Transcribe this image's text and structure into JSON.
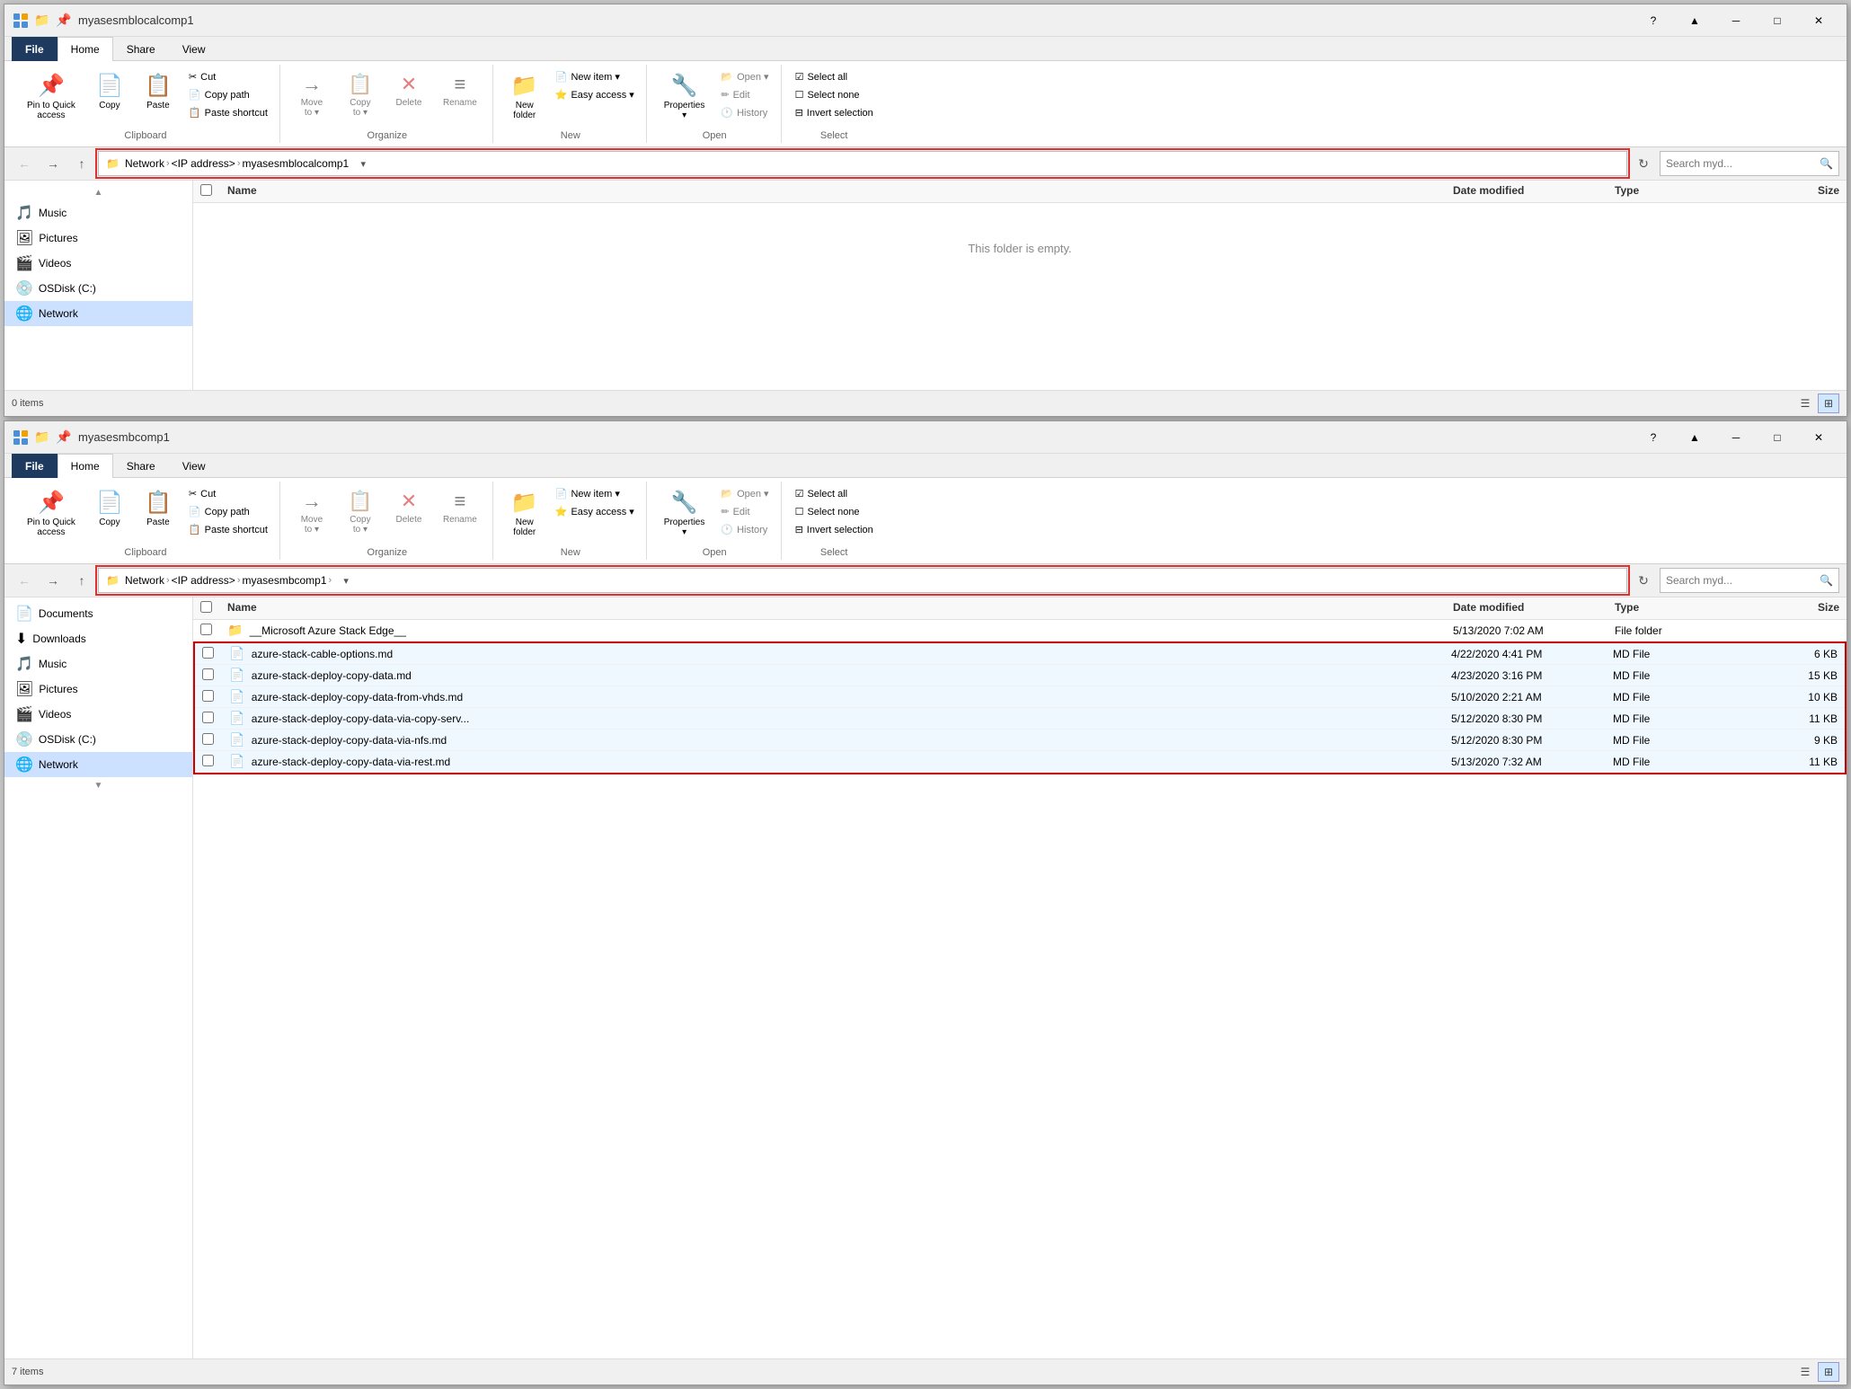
{
  "window1": {
    "title": "myasesmblocalcomp1",
    "tabs": [
      "File",
      "Home",
      "Share",
      "View"
    ],
    "active_tab": "Home",
    "ribbon": {
      "groups": {
        "clipboard": {
          "label": "Clipboard",
          "buttons": [
            {
              "id": "pin",
              "label": "Pin to Quick\naccess",
              "icon": "📌"
            },
            {
              "id": "copy",
              "label": "Copy",
              "icon": "📄"
            },
            {
              "id": "paste",
              "label": "Paste",
              "icon": "📋"
            }
          ],
          "small_buttons": [
            {
              "id": "cut",
              "label": "Cut",
              "icon": "✂"
            },
            {
              "id": "copy_path",
              "label": "Copy path",
              "icon": "📄"
            },
            {
              "id": "paste_shortcut",
              "label": "Paste shortcut",
              "icon": "📋"
            }
          ]
        },
        "organize": {
          "label": "Organize",
          "buttons": [
            {
              "id": "move_to",
              "label": "Move\nto ▾",
              "icon": "→"
            },
            {
              "id": "copy_to",
              "label": "Copy\nto ▾",
              "icon": "📋"
            },
            {
              "id": "delete",
              "label": "Delete",
              "icon": "✕"
            },
            {
              "id": "rename",
              "label": "Rename",
              "icon": "≡"
            }
          ]
        },
        "new": {
          "label": "New",
          "buttons": [
            {
              "id": "new_folder",
              "label": "New\nfolder",
              "icon": "📁"
            },
            {
              "id": "new_item",
              "label": "New item ▾",
              "icon": ""
            },
            {
              "id": "easy_access",
              "label": "Easy access ▾",
              "icon": ""
            }
          ]
        },
        "open": {
          "label": "Open",
          "buttons": [
            {
              "id": "properties",
              "label": "Properties\n▾",
              "icon": "🔧"
            },
            {
              "id": "open",
              "label": "Open ▾",
              "icon": ""
            },
            {
              "id": "edit",
              "label": "Edit",
              "icon": ""
            },
            {
              "id": "history",
              "label": "History",
              "icon": ""
            }
          ]
        },
        "select": {
          "label": "Select",
          "buttons": [
            {
              "id": "select_all",
              "label": "Select all",
              "icon": ""
            },
            {
              "id": "select_none",
              "label": "Select none",
              "icon": ""
            },
            {
              "id": "invert",
              "label": "Invert selection",
              "icon": ""
            }
          ]
        }
      }
    },
    "address": {
      "breadcrumb": [
        "Network",
        "<IP address>",
        "myasesmblocalcomp1"
      ],
      "search_placeholder": "Search myd..."
    },
    "sidebar_items": [
      {
        "label": "Music",
        "icon": "🎵"
      },
      {
        "label": "Pictures",
        "icon": "🖼"
      },
      {
        "label": "Videos",
        "icon": "🎬"
      },
      {
        "label": "OSDisk (C:)",
        "icon": "💿"
      },
      {
        "label": "Network",
        "icon": "🌐",
        "selected": true
      }
    ],
    "file_list": {
      "columns": [
        "Name",
        "Date modified",
        "Type",
        "Size"
      ],
      "items": [],
      "empty_message": "This folder is empty."
    },
    "status": "0 items"
  },
  "window2": {
    "title": "myasesmbcomp1",
    "tabs": [
      "File",
      "Home",
      "Share",
      "View"
    ],
    "active_tab": "Home",
    "ribbon": {
      "groups": {
        "clipboard": {
          "label": "Clipboard",
          "buttons": [
            {
              "id": "pin",
              "label": "Pin to Quick\naccess",
              "icon": "📌"
            },
            {
              "id": "copy",
              "label": "Copy",
              "icon": "📄"
            },
            {
              "id": "paste",
              "label": "Paste",
              "icon": "📋"
            }
          ],
          "small_buttons": [
            {
              "id": "cut",
              "label": "Cut",
              "icon": "✂"
            },
            {
              "id": "copy_path",
              "label": "Copy path",
              "icon": "📄"
            },
            {
              "id": "paste_shortcut",
              "label": "Paste shortcut",
              "icon": "📋"
            }
          ]
        },
        "organize": {
          "label": "Organize",
          "buttons": [
            {
              "id": "move_to",
              "label": "Move\nto ▾",
              "icon": "→"
            },
            {
              "id": "copy_to",
              "label": "Copy\nto ▾",
              "icon": "📋"
            },
            {
              "id": "delete",
              "label": "Delete",
              "icon": "✕"
            },
            {
              "id": "rename",
              "label": "Rename",
              "icon": "≡"
            }
          ]
        },
        "new": {
          "label": "New",
          "buttons": [
            {
              "id": "new_folder",
              "label": "New\nfolder",
              "icon": "📁"
            },
            {
              "id": "new_item",
              "label": "New item ▾",
              "icon": ""
            },
            {
              "id": "easy_access",
              "label": "Easy access ▾",
              "icon": ""
            }
          ]
        },
        "open": {
          "label": "Open",
          "buttons": [
            {
              "id": "properties",
              "label": "Properties\n▾",
              "icon": "🔧"
            },
            {
              "id": "open",
              "label": "Open ▾",
              "icon": ""
            },
            {
              "id": "edit",
              "label": "Edit",
              "icon": ""
            },
            {
              "id": "history",
              "label": "History",
              "icon": ""
            }
          ]
        },
        "select": {
          "label": "Select",
          "buttons": [
            {
              "id": "select_all",
              "label": "Select all",
              "icon": ""
            },
            {
              "id": "select_none",
              "label": "Select none",
              "icon": ""
            },
            {
              "id": "invert",
              "label": "Invert selection",
              "icon": ""
            }
          ]
        }
      }
    },
    "address": {
      "breadcrumb": [
        "Network",
        "<IP address>",
        "myasesmbcomp1",
        ""
      ],
      "search_placeholder": "Search myd..."
    },
    "sidebar_items": [
      {
        "label": "Documents",
        "icon": "📄"
      },
      {
        "label": "Downloads",
        "icon": "⬇"
      },
      {
        "label": "Music",
        "icon": "🎵"
      },
      {
        "label": "Pictures",
        "icon": "🖼"
      },
      {
        "label": "Videos",
        "icon": "🎬"
      },
      {
        "label": "OSDisk (C:)",
        "icon": "💿"
      },
      {
        "label": "Network",
        "icon": "🌐",
        "selected": true
      }
    ],
    "file_list": {
      "columns": [
        "Name",
        "Date modified",
        "Type",
        "Size"
      ],
      "items": [
        {
          "name": "__Microsoft Azure Stack Edge__",
          "date": "5/13/2020 7:02 AM",
          "type": "File folder",
          "size": "",
          "icon": "📁",
          "highlighted": false
        },
        {
          "name": "azure-stack-cable-options.md",
          "date": "4/22/2020 4:41 PM",
          "type": "MD File",
          "size": "6 KB",
          "icon": "📄",
          "highlighted": true
        },
        {
          "name": "azure-stack-deploy-copy-data.md",
          "date": "4/23/2020 3:16 PM",
          "type": "MD File",
          "size": "15 KB",
          "icon": "📄",
          "highlighted": true
        },
        {
          "name": "azure-stack-deploy-copy-data-from-vhds.md",
          "date": "5/10/2020 2:21 AM",
          "type": "MD File",
          "size": "10 KB",
          "icon": "📄",
          "highlighted": true
        },
        {
          "name": "azure-stack-deploy-copy-data-via-copy-serv...",
          "date": "5/12/2020 8:30 PM",
          "type": "MD File",
          "size": "11 KB",
          "icon": "📄",
          "highlighted": true
        },
        {
          "name": "azure-stack-deploy-copy-data-via-nfs.md",
          "date": "5/12/2020 8:30 PM",
          "type": "MD File",
          "size": "9 KB",
          "icon": "📄",
          "highlighted": true
        },
        {
          "name": "azure-stack-deploy-copy-data-via-rest.md",
          "date": "5/13/2020 7:32 AM",
          "type": "MD File",
          "size": "11 KB",
          "icon": "📄",
          "highlighted": true
        }
      ]
    },
    "status": "7 items"
  },
  "icons": {
    "back": "←",
    "forward": "→",
    "up": "↑",
    "refresh": "↻",
    "search": "🔍",
    "minimize": "─",
    "maximize": "□",
    "close": "✕",
    "help": "?",
    "chevron_up": "▲",
    "chevron_down": "▾",
    "view_list": "≡",
    "view_details": "⊞",
    "check": "✓",
    "dropdown": "▾"
  }
}
